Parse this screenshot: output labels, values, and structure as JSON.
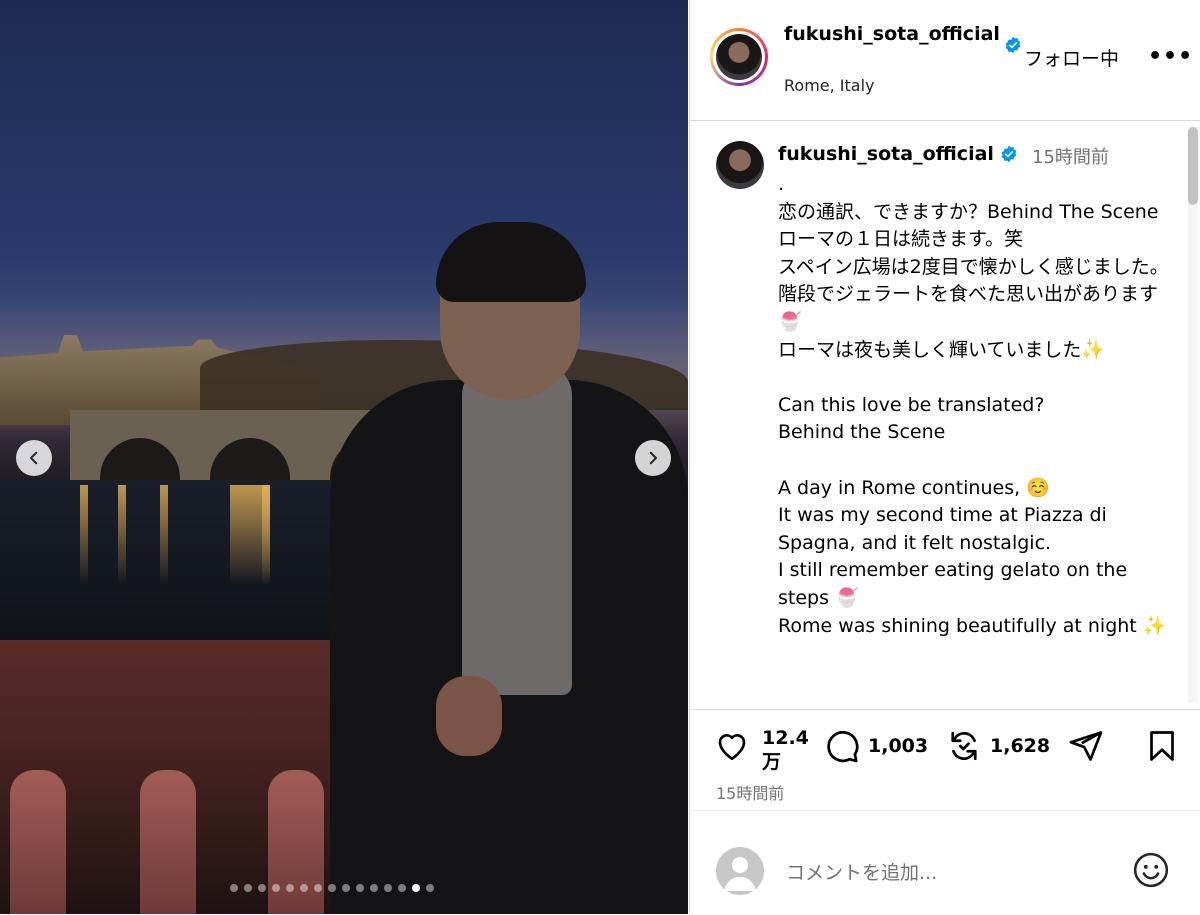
{
  "header": {
    "username": "fukushi_sota_official",
    "follow_status": "フォロー中",
    "more": "•••",
    "location": "Rome, Italy"
  },
  "caption": {
    "username": "fukushi_sota_official",
    "time": "15時間前",
    "text": ".\n恋の通訳、できますか？Behind The Scene\nローマの１日は続きます。笑\nスペイン広場は2度目で懐かしく感じました。階段でジェラートを食べた思い出があります🍧\nローマは夜も美しく輝いていました✨\n\nCan this love be translated?\nBehind the Scene\n\nA day in Rome continues, ☺️\nIt was my second time at Piazza di Spagna, and it felt nostalgic.\nI still remember eating gelato on the steps 🍧\nRome was shining beautifully at night ✨"
  },
  "actions": {
    "likes": "12.4万",
    "comments": "1,003",
    "reposts": "1,628",
    "post_time": "15時間前"
  },
  "comment_box": {
    "placeholder": "コメントを追加..."
  },
  "carousel": {
    "total": 15,
    "active_index": 13
  },
  "colors": {
    "verified": "#0095f6",
    "muted": "#737373",
    "border": "#dbdbdb"
  }
}
